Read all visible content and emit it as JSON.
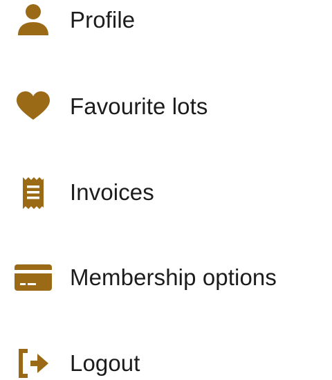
{
  "menu": {
    "accent_color": "#9a6a17",
    "items": [
      {
        "label": "Profile",
        "icon": "user-icon"
      },
      {
        "label": "Favourite lots",
        "icon": "heart-icon"
      },
      {
        "label": "Invoices",
        "icon": "receipt-icon"
      },
      {
        "label": "Membership options",
        "icon": "credit-card-icon"
      },
      {
        "label": "Logout",
        "icon": "logout-icon"
      }
    ]
  }
}
